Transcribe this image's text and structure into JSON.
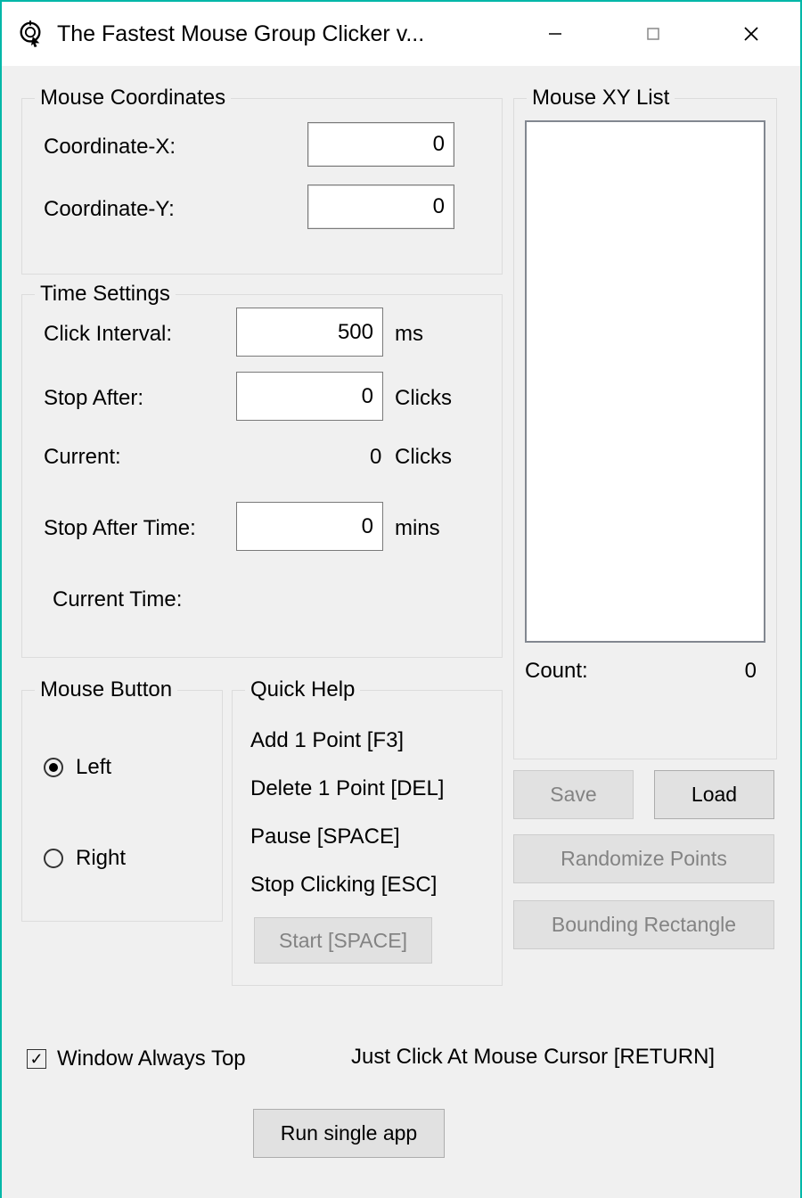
{
  "window": {
    "title": "The Fastest Mouse Group Clicker v..."
  },
  "mouseCoords": {
    "legend": "Mouse Coordinates",
    "xLabel": "Coordinate-X:",
    "yLabel": "Coordinate-Y:",
    "x": "0",
    "y": "0"
  },
  "timeSettings": {
    "legend": "Time Settings",
    "intervalLabel": "Click Interval:",
    "intervalValue": "500",
    "intervalUnit": "ms",
    "stopAfterLabel": "Stop After:",
    "stopAfterValue": "0",
    "stopAfterUnit": "Clicks",
    "currentLabel": "Current:",
    "currentValue": "0",
    "currentUnit": "Clicks",
    "stopAfterTimeLabel": "Stop After Time:",
    "stopAfterTimeValue": "0",
    "stopAfterTimeUnit": "mins",
    "currentTimeLabel": "Current Time:"
  },
  "mouseButton": {
    "legend": "Mouse Button",
    "left": "Left",
    "right": "Right",
    "selected": "left"
  },
  "quickHelp": {
    "legend": "Quick Help",
    "add": "Add 1 Point [F3]",
    "delete": "Delete 1 Point [DEL]",
    "pause": "Pause [SPACE]",
    "stop": "Stop Clicking [ESC]",
    "start": "Start [SPACE]"
  },
  "xyList": {
    "legend": "Mouse XY List",
    "countLabel": "Count:",
    "countValue": "0"
  },
  "buttons": {
    "save": "Save",
    "load": "Load",
    "randomize": "Randomize Points",
    "bounding": "Bounding Rectangle",
    "runSingle": "Run single app"
  },
  "footer": {
    "alwaysTop": "Window Always Top",
    "justClick": "Just Click At Mouse Cursor [RETURN]"
  }
}
